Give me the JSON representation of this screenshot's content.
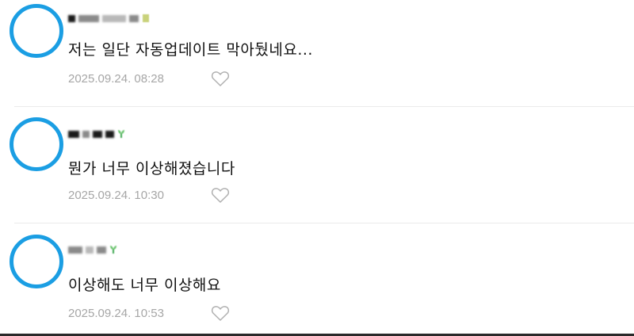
{
  "colors": {
    "avatar_ring": "#1b9ee3",
    "date_text": "#a6a6a6",
    "divider": "#ebebeb",
    "heart_outline": "#b0b0b0"
  },
  "comments": [
    {
      "author": "",
      "text": "저는 일단 자동업데이트 막아뒀네요...",
      "date": "2025.09.24. 08:28",
      "like_icon": "heart-outline-icon"
    },
    {
      "author": "",
      "text": "뭔가 너무 이상해졌습니다",
      "date": "2025.09.24. 10:30",
      "like_icon": "heart-outline-icon"
    },
    {
      "author": "",
      "text": "이상해도 너무 이상해요",
      "date": "2025.09.24. 10:53",
      "like_icon": "heart-outline-icon"
    }
  ]
}
